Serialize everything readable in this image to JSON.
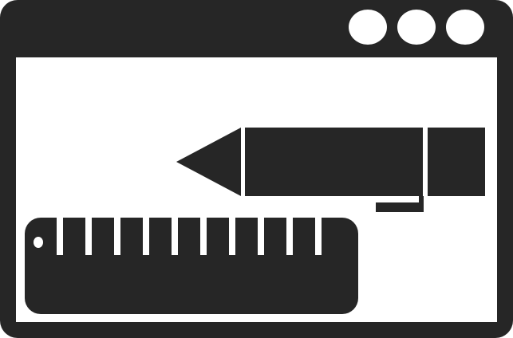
{
  "icon": {
    "name": "window-with-pencil-and-ruler-icon",
    "colors": {
      "foreground": "#262626",
      "background": "#ffffff"
    },
    "window_controls": [
      "window-control-icon",
      "window-control-icon",
      "window-control-icon"
    ],
    "ruler": {
      "tick_count": 10
    }
  }
}
